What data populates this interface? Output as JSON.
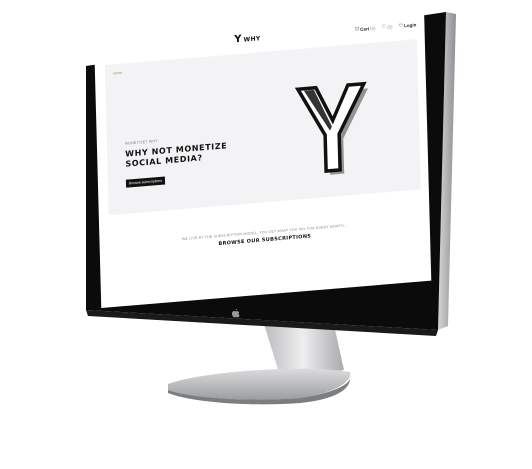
{
  "header": {
    "logo_glyph": "Y",
    "logo_text": "WHY",
    "cart_label": "Cart",
    "cart_count": "(0)",
    "wishlist_count": "(0)",
    "login_label": "Login"
  },
  "hero": {
    "breadcrumb": "Home",
    "eyebrow": "MONETIZE? WHY",
    "title": "WHY NOT MONETIZE SOCIAL MEDIA?",
    "button_label": "Browse subscriptions",
    "graphic_letter": "Y"
  },
  "subscriptions": {
    "intro": "WE LIVE BY THE SUBSCRIPTION MODEL. YOU GET WHAT YOU PAY FOR EVERY MONTH...",
    "cta": "BROWSE OUR SUBSCRIPTIONS"
  },
  "colors": {
    "accent": "#9aa62a",
    "hero_bg": "#f3f3f6",
    "bezel": "#0b0b0b",
    "frame_silver": "#c9cacc"
  },
  "icons": [
    "cart-icon",
    "heart-icon",
    "user-icon",
    "apple-logo-icon"
  ]
}
